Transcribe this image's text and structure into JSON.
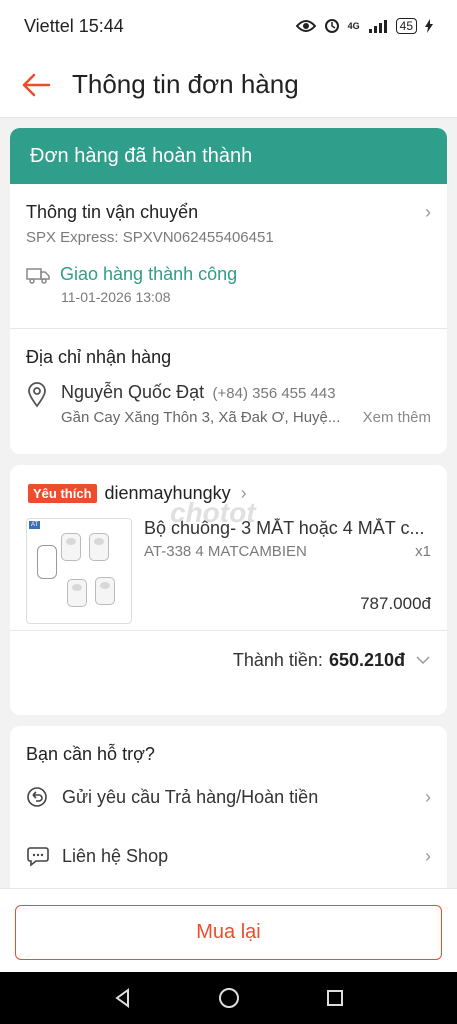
{
  "status_bar": {
    "carrier_time": "Viettel 15:44",
    "network": "4G",
    "battery": "45"
  },
  "header": {
    "title": "Thông tin đơn hàng"
  },
  "order_status": {
    "banner": "Đơn hàng đã hoàn thành"
  },
  "shipping": {
    "title": "Thông tin vận chuyển",
    "tracking": "SPX Express: SPXVN062455406451",
    "status": "Giao hàng thành công",
    "datetime": "11-01-2026 13:08"
  },
  "address": {
    "title": "Địa chỉ nhận hàng",
    "name": "Nguyễn Quốc Đạt",
    "phone": "(+84) 356 455 443",
    "line": "Gần Cay Xăng Thôn 3, Xã Đak Ơ, Huyệ...",
    "see_more": "Xem thêm"
  },
  "shop": {
    "tag": "Yêu thích",
    "name": "dienmayhungky",
    "watermark": "chotot"
  },
  "product": {
    "name": "Bộ chuông- 3 MẮT hoặc 4 MẮT c...",
    "variant": "AT-338 4 MATCAMBIEN",
    "qty": "x1",
    "price": "787.000đ"
  },
  "total": {
    "label": "Thành tiền:",
    "value": "650.210đ"
  },
  "support": {
    "title": "Bạn cần hỗ trợ?",
    "items": [
      {
        "label": "Gửi yêu cầu Trả hàng/Hoàn tiền",
        "icon": "return-icon"
      },
      {
        "label": "Liên hệ Shop",
        "icon": "chat-icon"
      }
    ]
  },
  "footer": {
    "buy_again": "Mua lại"
  },
  "colors": {
    "accent": "#ee4d2d",
    "teal": "#2f9e8a"
  }
}
